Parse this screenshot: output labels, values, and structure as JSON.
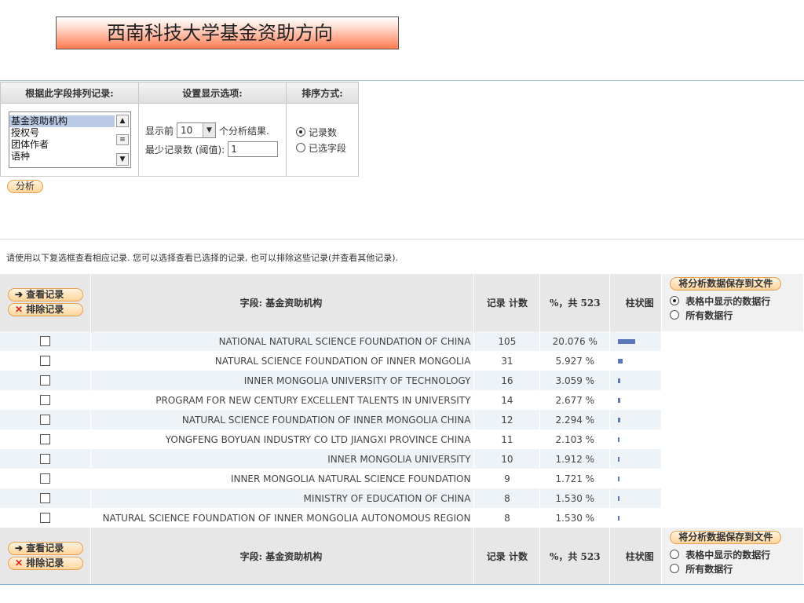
{
  "title": "西南科技大学基金资助方向",
  "options": {
    "col1_header": "根据此字段排列记录:",
    "col2_header": "设置显示选项:",
    "col3_header": "排序方式:",
    "fields": [
      "基金资助机构",
      "授权号",
      "团体作者",
      "语种"
    ],
    "show_prefix": "显示前",
    "show_value": "10",
    "show_suffix": "个分析结果.",
    "threshold_label": "最少记录数 (阈值):",
    "threshold_value": "1",
    "sort_record_count": "记录数",
    "sort_selected_field": "已选字段",
    "analyze_button": "分析"
  },
  "instructions": "请使用以下复选框查看相应记录. 您可以选择查看已选择的记录, 也可以排除这些记录(并查看其他记录).",
  "table": {
    "view_records": "查看记录",
    "exclude_records": "排除记录",
    "field_header": "字段: 基金资助机构",
    "count_header": "记录 计数",
    "pct_header": "%，共 523",
    "bar_header": "柱状图",
    "save_button": "将分析数据保存到文件",
    "save_opt_table": "表格中显示的数据行",
    "save_opt_all": "所有数据行",
    "rows": [
      {
        "name": "NATIONAL NATURAL SCIENCE FOUNDATION OF CHINA",
        "count": "105",
        "pct": "20.076 %",
        "share": 0.20076
      },
      {
        "name": "NATURAL SCIENCE FOUNDATION OF INNER MONGOLIA",
        "count": "31",
        "pct": "5.927 %",
        "share": 0.05927
      },
      {
        "name": "INNER MONGOLIA UNIVERSITY OF TECHNOLOGY",
        "count": "16",
        "pct": "3.059 %",
        "share": 0.03059
      },
      {
        "name": "PROGRAM FOR NEW CENTURY EXCELLENT TALENTS IN UNIVERSITY",
        "count": "14",
        "pct": "2.677 %",
        "share": 0.02677
      },
      {
        "name": "NATURAL SCIENCE FOUNDATION OF INNER MONGOLIA CHINA",
        "count": "12",
        "pct": "2.294 %",
        "share": 0.02294
      },
      {
        "name": "YONGFENG BOYUAN INDUSTRY CO LTD JIANGXI PROVINCE CHINA",
        "count": "11",
        "pct": "2.103 %",
        "share": 0.02103
      },
      {
        "name": "INNER MONGOLIA UNIVERSITY",
        "count": "10",
        "pct": "1.912 %",
        "share": 0.01912
      },
      {
        "name": "INNER MONGOLIA NATURAL SCIENCE FOUNDATION",
        "count": "9",
        "pct": "1.721 %",
        "share": 0.01721
      },
      {
        "name": "MINISTRY OF EDUCATION OF CHINA",
        "count": "8",
        "pct": "1.530 %",
        "share": 0.0153
      },
      {
        "name": "NATURAL SCIENCE FOUNDATION OF INNER MONGOLIA AUTONOMOUS REGION",
        "count": "8",
        "pct": "1.530 %",
        "share": 0.0153
      }
    ]
  },
  "colors": {
    "bar": "#5a78b8",
    "title_gradient_end": "#ff7a50",
    "button_border": "#e8a050"
  }
}
